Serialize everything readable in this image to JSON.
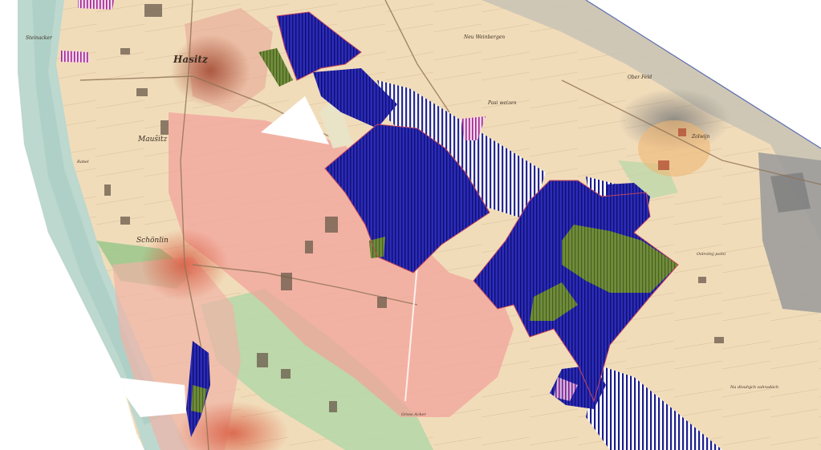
{
  "map": {
    "place_labels": {
      "hasitz": "Hasitz",
      "mausitz": "Maušitz",
      "schonlin": "Schönlin",
      "neu_weinbergen": "Neu Weinbergen",
      "ober_feld": "Ober Feld",
      "pasi_weizen": "Pasi weizen",
      "east_village": "Zolwijn",
      "east_field": "Ostrolný polní",
      "south_field": "Na dlouhých zahradách",
      "steinacker": "Steinacker",
      "gross_acker": "Gross Acker",
      "rabel": "Rabel"
    },
    "colors": {
      "base_paper": "#f1dcba",
      "urban_pink": "#f2a49b",
      "meadow_green": "#b7d7a8",
      "river_blue": "#bcd8cf",
      "hatch_blue": "#1c1eaa",
      "olive": "#6f8d3a",
      "magenta_hatch": "#c03a9a",
      "gray_area": "#9a9a9a"
    }
  }
}
